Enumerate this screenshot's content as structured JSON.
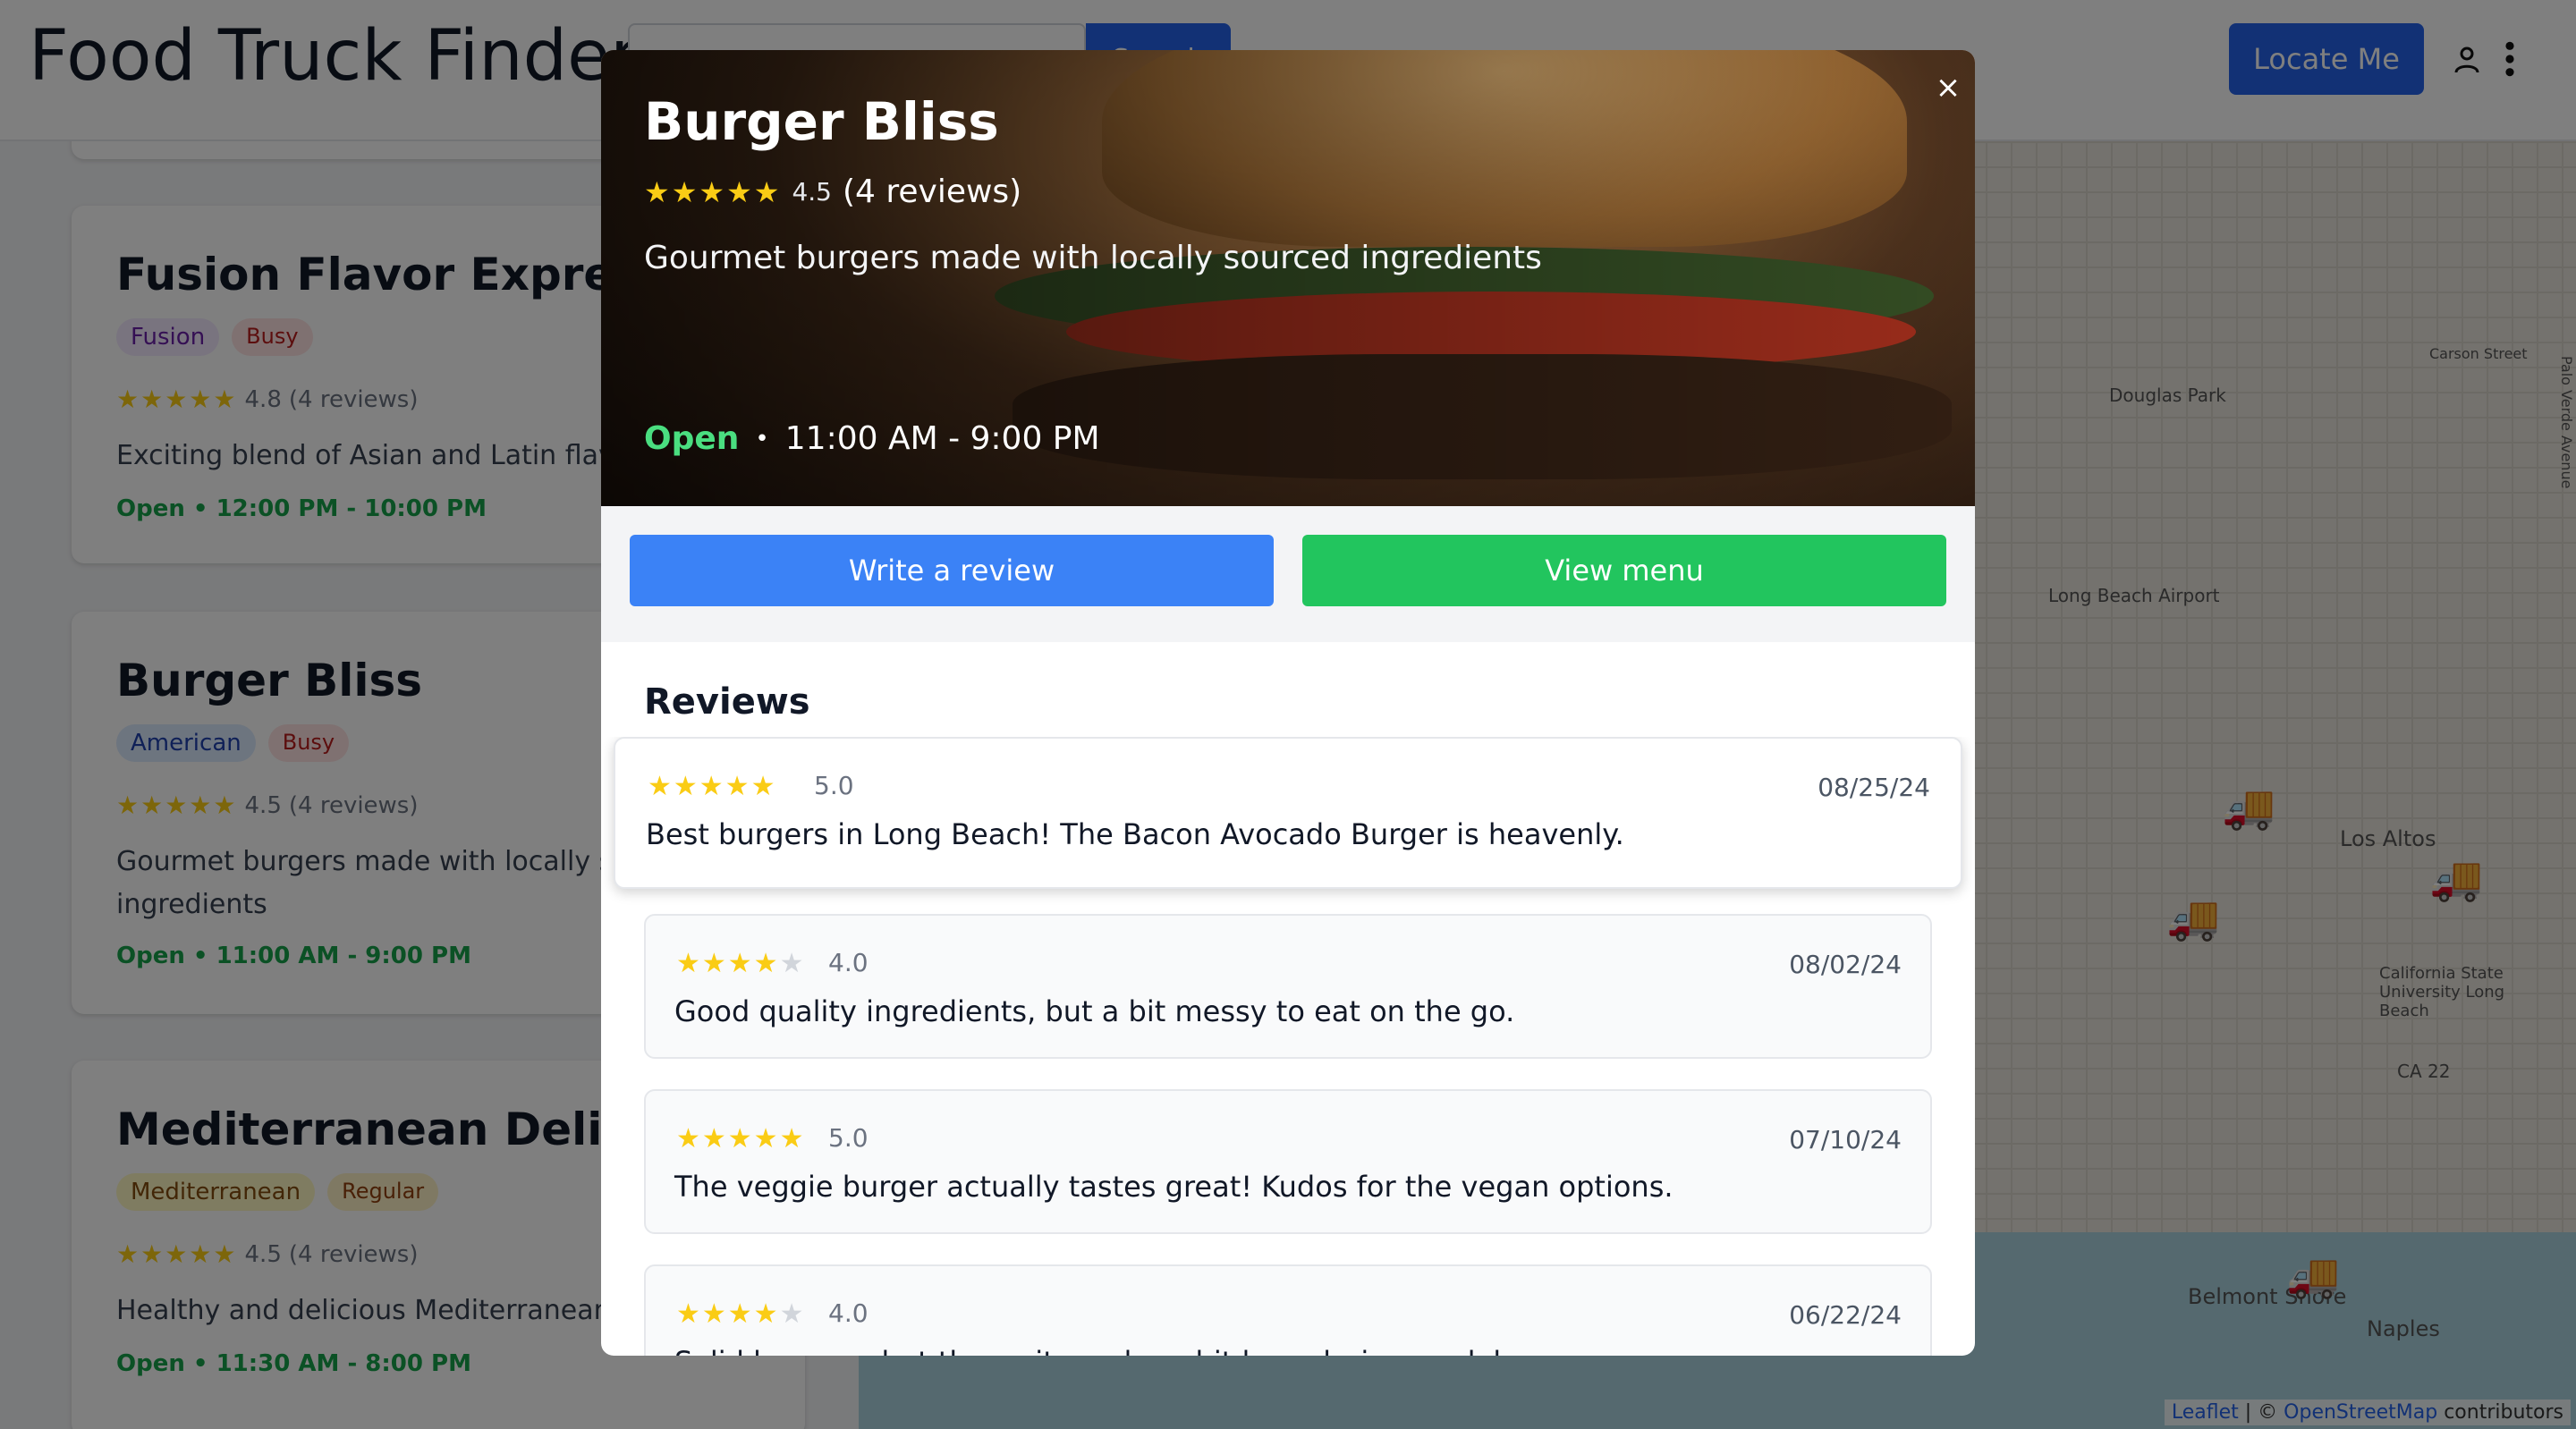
{
  "header": {
    "title": "Food Truck Finder",
    "search_placeholder": "",
    "search_button": "Search",
    "locate_button": "Locate Me",
    "icons": [
      "user-icon",
      "more-vertical-icon"
    ]
  },
  "sidebar": {
    "cards": [
      {
        "name": "Fusion Flavor Express",
        "cuisine": "Fusion",
        "busyness": "Busy",
        "stars": "★★★★★",
        "rating": "4.8",
        "reviews": "(4 reviews)",
        "description": "Exciting blend of Asian and Latin flavors",
        "status": "Open",
        "hours": "12:00 PM - 10:00 PM"
      },
      {
        "name": "Burger Bliss",
        "cuisine": "American",
        "busyness": "Busy",
        "stars": "★★★★★",
        "rating": "4.5",
        "reviews": "(4 reviews)",
        "description": "Gourmet burgers made with locally sourced ingredients",
        "status": "Open",
        "hours": "11:00 AM - 9:00 PM"
      },
      {
        "name": "Mediterranean Delights",
        "cuisine": "Mediterranean",
        "busyness": "Regular",
        "stars": "★★★★★",
        "rating": "4.5",
        "reviews": "(4 reviews)",
        "description": "Healthy and delicious Mediterranean street food",
        "status": "Open",
        "hours": "11:30 AM - 8:00 PM"
      }
    ]
  },
  "map": {
    "labels": [
      "Douglas Park",
      "Long Beach Airport",
      "Los Altos",
      "California State University Long Beach",
      "CA 22",
      "Belmont Shore",
      "Naples",
      "Carson Street",
      "Palo Verde Avenue"
    ],
    "attribution": {
      "leaflet": "Leaflet",
      "separator": " | © ",
      "osm": "OpenStreetMap",
      "suffix": " contributors"
    }
  },
  "modal": {
    "name": "Burger Bliss",
    "stars": "★★★★★",
    "rating": "4.5",
    "reviews_count": "(4 reviews)",
    "description": "Gourmet burgers made with locally sourced ingredients",
    "status": "Open",
    "separator": "•",
    "hours": "11:00 AM - 9:00 PM",
    "close": "×",
    "write_review": "Write a review",
    "view_menu": "View menu",
    "reviews_title": "Reviews",
    "reviews": [
      {
        "stars_on": "★★★★★",
        "stars_off": "",
        "score": "5.0",
        "date": "08/25/24",
        "text": "Best burgers in Long Beach! The Bacon Avocado Burger is heavenly."
      },
      {
        "stars_on": "★★★★",
        "stars_off": "★",
        "score": "4.0",
        "date": "08/02/24",
        "text": "Good quality ingredients, but a bit messy to eat on the go."
      },
      {
        "stars_on": "★★★★★",
        "stars_off": "",
        "score": "5.0",
        "date": "07/10/24",
        "text": "The veggie burger actually tastes great! Kudos for the vegan options."
      },
      {
        "stars_on": "★★★★",
        "stars_off": "★",
        "score": "4.0",
        "date": "06/22/24",
        "text": "Solid burgers, but the wait can be a bit long during peak hours."
      }
    ]
  },
  "colors": {
    "primary": "#2563eb",
    "review_button": "#3b82f6",
    "menu_button": "#22c55e",
    "open_status": "#4ade80",
    "star": "#facc15"
  }
}
